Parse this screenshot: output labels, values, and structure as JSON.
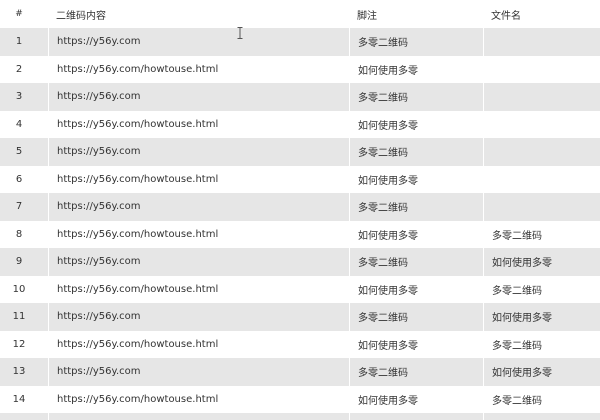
{
  "table": {
    "columns": {
      "index": "#",
      "content": "二维码内容",
      "note": "脚注",
      "file": "文件名"
    },
    "rows": [
      {
        "index": "1",
        "content": "https://y56y.com",
        "note": "多零二维码",
        "file": ""
      },
      {
        "index": "2",
        "content": "https://y56y.com/howtouse.html",
        "note": "如何使用多零",
        "file": ""
      },
      {
        "index": "3",
        "content": "https://y56y.com",
        "note": "多零二维码",
        "file": ""
      },
      {
        "index": "4",
        "content": "https://y56y.com/howtouse.html",
        "note": "如何使用多零",
        "file": ""
      },
      {
        "index": "5",
        "content": "https://y56y.com",
        "note": "多零二维码",
        "file": ""
      },
      {
        "index": "6",
        "content": "https://y56y.com/howtouse.html",
        "note": "如何使用多零",
        "file": ""
      },
      {
        "index": "7",
        "content": "https://y56y.com",
        "note": "多零二维码",
        "file": ""
      },
      {
        "index": "8",
        "content": "https://y56y.com/howtouse.html",
        "note": "如何使用多零",
        "file": "多零二维码"
      },
      {
        "index": "9",
        "content": "https://y56y.com",
        "note": "多零二维码",
        "file": "如何使用多零"
      },
      {
        "index": "10",
        "content": "https://y56y.com/howtouse.html",
        "note": "如何使用多零",
        "file": "多零二维码"
      },
      {
        "index": "11",
        "content": "https://y56y.com",
        "note": "多零二维码",
        "file": "如何使用多零"
      },
      {
        "index": "12",
        "content": "https://y56y.com/howtouse.html",
        "note": "如何使用多零",
        "file": "多零二维码"
      },
      {
        "index": "13",
        "content": "https://y56y.com",
        "note": "多零二维码",
        "file": "如何使用多零"
      },
      {
        "index": "14",
        "content": "https://y56y.com/howtouse.html",
        "note": "如何使用多零",
        "file": "多零二维码"
      },
      {
        "index": "",
        "content": "",
        "note": "",
        "file": ""
      }
    ]
  },
  "cursor": {
    "icon": "text-cursor-icon"
  }
}
